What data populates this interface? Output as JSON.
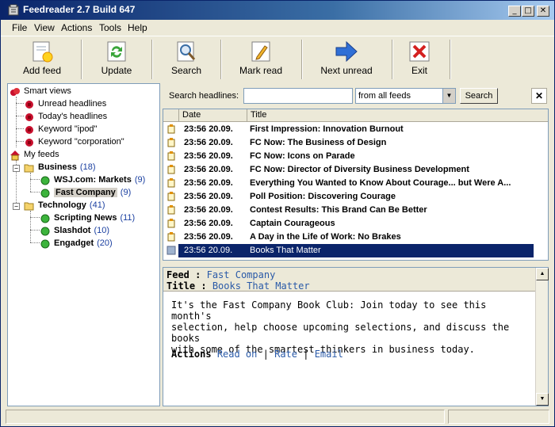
{
  "window": {
    "title": "Feedreader 2.7 Build 647",
    "minimize": "_",
    "maximize": "□",
    "close": "✕"
  },
  "menu": [
    "File",
    "View",
    "Actions",
    "Tools",
    "Help"
  ],
  "toolbar": {
    "add_feed": "Add feed",
    "update": "Update",
    "search": "Search",
    "mark_read": "Mark read",
    "next_unread": "Next unread",
    "exit": "Exit"
  },
  "tree": {
    "smart_views": "Smart views",
    "unread": "Unread headlines",
    "today": "Today's headlines",
    "kw_ipod": "Keyword \"ipod\"",
    "kw_corp": "Keyword \"corporation\"",
    "my_feeds": "My feeds",
    "business": {
      "label": "Business",
      "count": "(18)"
    },
    "wsj": {
      "label": "WSJ.com: Markets",
      "count": "(9)"
    },
    "fastco": {
      "label": "Fast Company",
      "count": "(9)"
    },
    "technology": {
      "label": "Technology",
      "count": "(41)"
    },
    "scripting": {
      "label": "Scripting News",
      "count": "(11)"
    },
    "slashdot": {
      "label": "Slashdot",
      "count": "(10)"
    },
    "engadget": {
      "label": "Engadget",
      "count": "(20)"
    }
  },
  "search": {
    "label": "Search headlines:",
    "value": "",
    "scope": "from all feeds",
    "button": "Search",
    "close": "✕"
  },
  "grid": {
    "col_date": "Date",
    "col_title": "Title",
    "rows": [
      {
        "date": "23:56 20.09.",
        "title": "First Impression: Innovation Burnout"
      },
      {
        "date": "23:56 20.09.",
        "title": "FC Now: The Business of Design"
      },
      {
        "date": "23:56 20.09.",
        "title": "FC Now: Icons on Parade"
      },
      {
        "date": "23:56 20.09.",
        "title": "FC Now: Director of Diversity Business Development"
      },
      {
        "date": "23:56 20.09.",
        "title": "Everything You Wanted to Know About Courage... but Were A..."
      },
      {
        "date": "23:56 20.09.",
        "title": "Poll Position: Discovering Courage"
      },
      {
        "date": "23:56 20.09.",
        "title": "Contest Results: This Brand Can Be Better"
      },
      {
        "date": "23:56 20.09.",
        "title": "Captain Courageous"
      },
      {
        "date": "23:56 20.09.",
        "title": "A Day in the Life of Work: No Brakes"
      },
      {
        "date": "23:56 20.09.",
        "title": "Books That Matter"
      }
    ]
  },
  "reader": {
    "feed_key": "Feed",
    "feed_value": "Fast Company",
    "title_key": "Title",
    "title_value": "Books That Matter",
    "sep": " : ",
    "body_1": "It's the Fast Company Book Club: Join today to see this month's",
    "body_2": "selection, help choose upcoming selections, and discuss the books",
    "body_3": "with some of the smartest thinkers in business today.",
    "actions_key": "Actions",
    "read_on": "Read on",
    "rate": "Rate",
    "email": "Email",
    "pipe": "|"
  },
  "colors": {
    "accent": "#0a246a",
    "link": "#2a5aa8",
    "count": "#1a3fa0"
  }
}
